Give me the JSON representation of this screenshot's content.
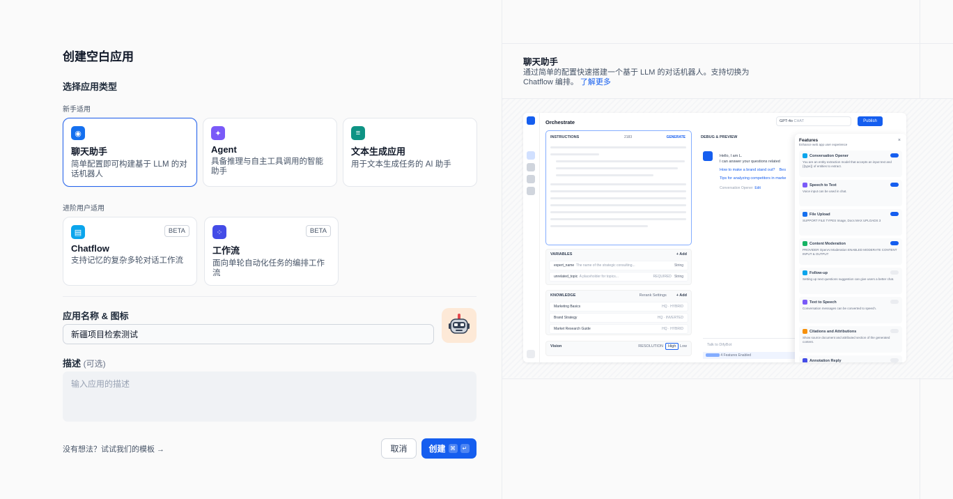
{
  "left": {
    "title": "创建空白应用",
    "select_type_label": "选择应用类型",
    "beginner_label": "新手适用",
    "advanced_label": "进阶用户适用",
    "beginner_cards": [
      {
        "title": "聊天助手",
        "desc": "简单配置即可构建基于 LLM 的对话机器人",
        "color": "#1570ef",
        "icon": "robot-icon",
        "selected": true
      },
      {
        "title": "Agent",
        "desc": "具备推理与自主工具调用的智能助手",
        "color": "#7a5af8",
        "icon": "agent-icon",
        "selected": false
      },
      {
        "title": "文本生成应用",
        "desc": "用于文本生成任务的 AI 助手",
        "color": "#0e9384",
        "icon": "text-generation-icon",
        "selected": false
      }
    ],
    "advanced_cards": [
      {
        "title": "Chatflow",
        "desc": "支持记忆的复杂多轮对话工作流",
        "badge": "BETA",
        "color": "#0ba5ec",
        "icon": "chatflow-icon"
      },
      {
        "title": "工作流",
        "desc": "面向单轮自动化任务的编排工作流",
        "badge": "BETA",
        "color": "#444ce7",
        "icon": "workflow-icon"
      }
    ],
    "name_label": "应用名称 & 图标",
    "name_value": "新疆项目检索测试",
    "desc_label": "描述",
    "desc_optional": "(可选)",
    "desc_placeholder": "输入应用的描述",
    "template_link": "没有想法？试试我们的模板 →",
    "cancel_label": "取消",
    "create_label": "创建",
    "create_kbd": [
      "⌘",
      "↵"
    ]
  },
  "right": {
    "title": "聊天助手",
    "desc": "通过简单的配置快速搭建一个基于 LLM 的对话机器人。支持切换为 Chatflow 编排。",
    "learn_more": "了解更多",
    "preview": {
      "title": "Orchestrate",
      "model": "GPT-4o",
      "model_tag": "CHAT",
      "publish": "Publish",
      "instructions": "INSTRUCTIONS",
      "instructions_count": "2183",
      "generate": "GENERATE",
      "variables": "VARIABLES",
      "variables_add": "+ Add",
      "variable_rows": [
        {
          "name": "expert_name",
          "desc": "The name of the strategic consulting...",
          "type": "String"
        },
        {
          "name": "unrelated_topic",
          "desc": "A placeholder for topics...",
          "tag": "REQUIRED",
          "type": "String"
        }
      ],
      "knowledge": "KNOWLEDGE",
      "rerank": "Rerank Settings",
      "knowledge_add": "+ Add",
      "knowledge_rows": [
        {
          "name": "Marketing Basics",
          "tag": "HQ · HYBRID"
        },
        {
          "name": "Brand Strategy",
          "tag": "HQ · INVERTED"
        },
        {
          "name": "Market Research Guide",
          "tag": "HQ · HYBRID"
        }
      ],
      "vision": "Vision",
      "resolution": "RESOLUTION",
      "res_high": "High",
      "res_low": "Low",
      "debug": "DEBUG & PREVIEW",
      "chat_hello": "Hello, I am L.",
      "chat_line": "I can answer your questions related",
      "chat_q1": "How to make a brand stand out?",
      "chat_q1_more": "Bes",
      "chat_q2": "Tips for analyzing competitors in marke",
      "opener_text": "Conversation Opener",
      "opener_edit": "Edit",
      "talk_placeholder": "Talk to DifyBot",
      "features_enabled": "4 Features Enabled",
      "features_title": "Features",
      "features_sub": "Enhance web app user experience",
      "features": [
        {
          "name": "Conversation Opener",
          "desc": "You are an entity extraction model that accepts an input text and {{type}} of entities to extract.",
          "on": true,
          "color": "#0ba5ec"
        },
        {
          "name": "Speech to Text",
          "desc": "Voice input can be used in chat.",
          "on": true,
          "color": "#7a5af8"
        },
        {
          "name": "File Upload",
          "desc": "SUPPORT FILE TYPES Image, Docs   MAX UPLOADS 3",
          "on": true,
          "color": "#1570ef"
        },
        {
          "name": "Content Moderation",
          "desc": "PROVIDER OpenAI Moderation   ENABLED MODERATE CONTENT INPUT & OUTPUT",
          "on": true,
          "color": "#16b364"
        },
        {
          "name": "Follow-up",
          "desc": "Setting up next questions suggestion can give users a better chat.",
          "on": false,
          "color": "#0ba5ec"
        },
        {
          "name": "Text to Speech",
          "desc": "Conversation messages can be converted to speech.",
          "on": false,
          "color": "#7a5af8"
        },
        {
          "name": "Citations and Attributions",
          "desc": "Show source document and attributed section of the generated content.",
          "on": false,
          "color": "#f79009"
        },
        {
          "name": "Annotation Reply",
          "desc": "",
          "on": false,
          "color": "#444ce7"
        }
      ]
    }
  }
}
